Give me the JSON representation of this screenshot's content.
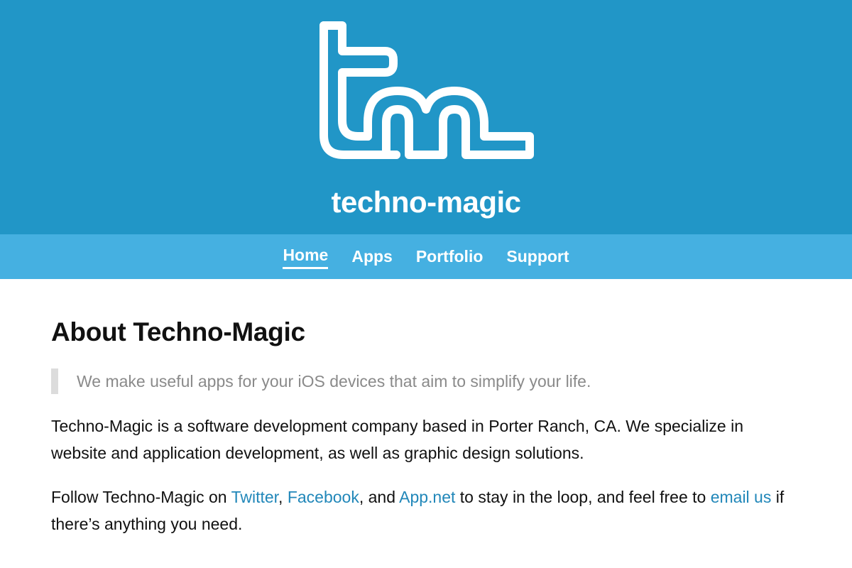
{
  "header": {
    "site_name": "techno-magic",
    "logo_icon": "tm-logo-icon",
    "background_color": "#2196c7"
  },
  "nav": {
    "background_color": "#45b0e1",
    "items": [
      {
        "label": "Home",
        "active": true
      },
      {
        "label": "Apps",
        "active": false
      },
      {
        "label": "Portfolio",
        "active": false
      },
      {
        "label": "Support",
        "active": false
      }
    ]
  },
  "main": {
    "title": "About Techno-Magic",
    "tagline": "We make useful apps for your iOS devices that aim to simplify your life.",
    "paragraph1": "Techno-Magic is a software development company based in Porter Ranch, CA. We specialize in website and application development, as well as graphic design solutions.",
    "paragraph2": {
      "part1": "Follow Techno-Magic on ",
      "twitter": "Twitter",
      "sep1": ", ",
      "facebook": "Facebook",
      "sep2": ", and ",
      "appnet": "App.net",
      "part2": " to stay in the loop, and feel free to ",
      "email": "email us",
      "part3": " if there’s anything you need."
    },
    "link_color": "#2187b9"
  }
}
